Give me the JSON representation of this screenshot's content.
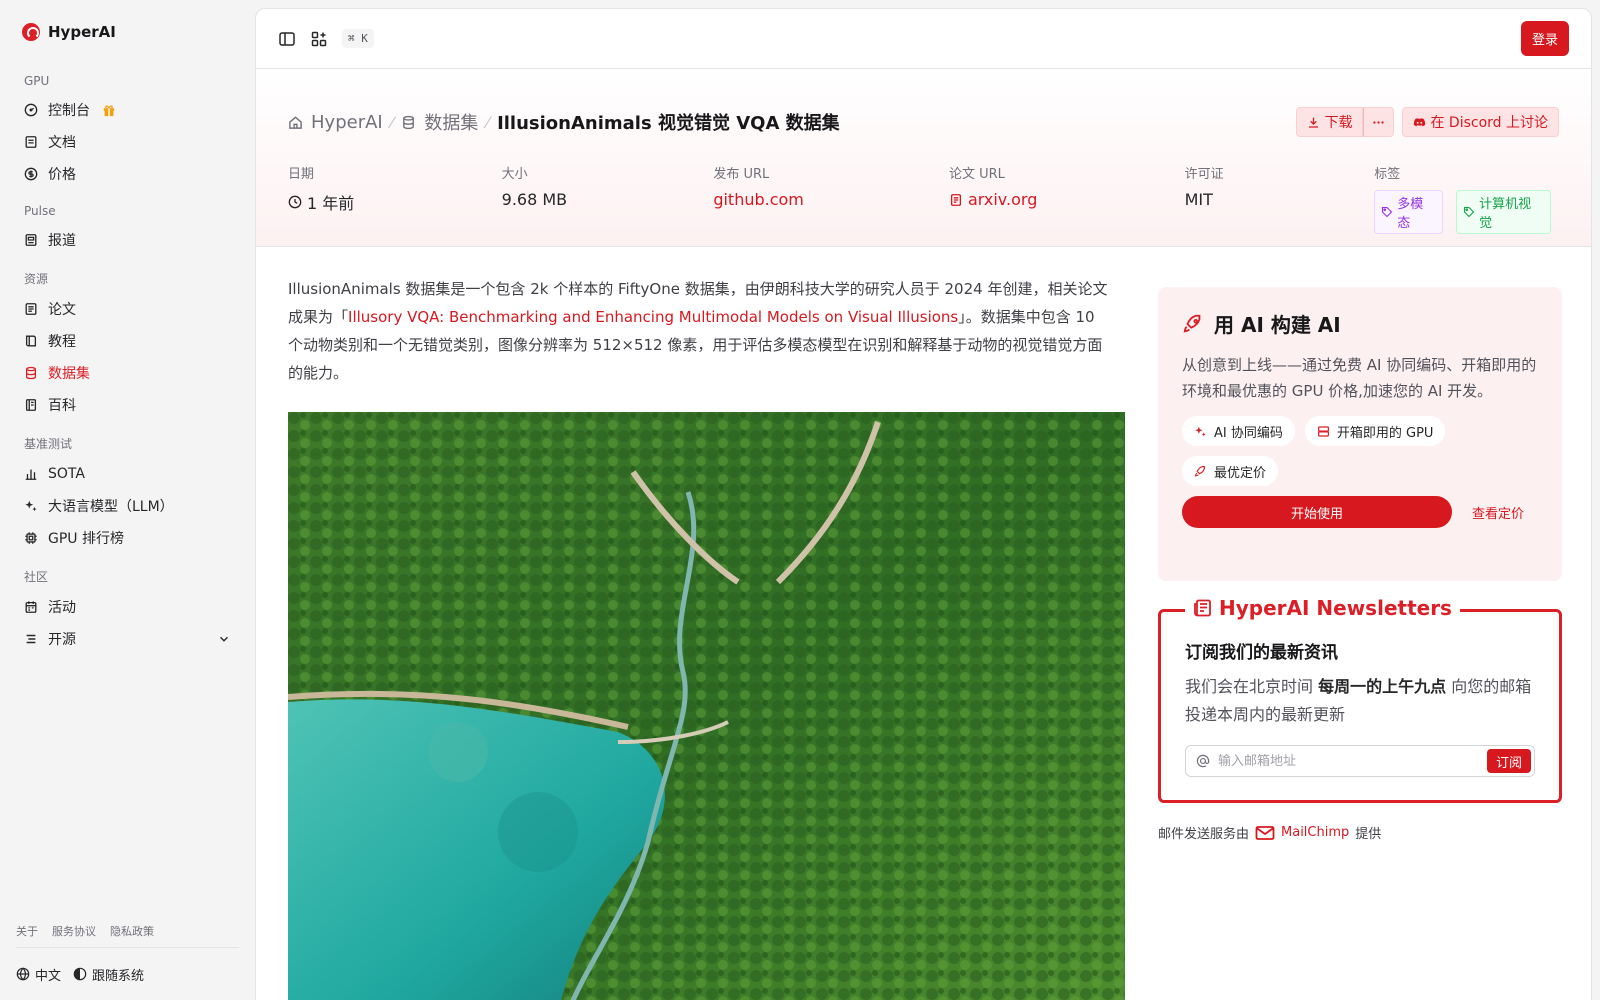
{
  "brand": {
    "name": "HyperAI",
    "color": "#dc1f26"
  },
  "sidebar": {
    "sections": [
      {
        "title": "GPU",
        "items": [
          {
            "label": "控制台",
            "icon": "gauge-icon",
            "badge": "gift-icon"
          },
          {
            "label": "文档",
            "icon": "document-icon"
          },
          {
            "label": "价格",
            "icon": "dollar-icon"
          }
        ]
      },
      {
        "title": "Pulse",
        "items": [
          {
            "label": "报道",
            "icon": "news-icon"
          }
        ]
      },
      {
        "title": "资源",
        "items": [
          {
            "label": "论文",
            "icon": "paper-icon"
          },
          {
            "label": "教程",
            "icon": "book-icon"
          },
          {
            "label": "数据集",
            "icon": "database-icon",
            "active": true
          },
          {
            "label": "百科",
            "icon": "encyclopedia-icon"
          }
        ]
      },
      {
        "title": "基准测试",
        "items": [
          {
            "label": "SOTA",
            "icon": "chart-icon"
          },
          {
            "label": "大语言模型（LLM）",
            "icon": "sparkle-icon"
          },
          {
            "label": "GPU 排行榜",
            "icon": "chip-icon"
          }
        ]
      },
      {
        "title": "社区",
        "items": [
          {
            "label": "活动",
            "icon": "calendar-icon"
          },
          {
            "label": "开源",
            "icon": "list-icon",
            "expandable": true
          }
        ]
      }
    ],
    "footer_links": [
      "关于",
      "服务协议",
      "隐私政策"
    ],
    "language": "中文",
    "theme": "跟随系统"
  },
  "topbar": {
    "shortcut": "⌘ K",
    "login": "登录"
  },
  "breadcrumb": {
    "home": "HyperAI",
    "section": "数据集",
    "current": "IllusionAnimals 视觉错觉 VQA 数据集"
  },
  "actions": {
    "download": "下载",
    "discord": "在 Discord 上讨论"
  },
  "meta": {
    "date": {
      "label": "日期",
      "value": "1 年前"
    },
    "size": {
      "label": "大小",
      "value": "9.68 MB"
    },
    "publish_url": {
      "label": "发布 URL",
      "value": "github.com"
    },
    "paper_url": {
      "label": "论文 URL",
      "value": "arxiv.org"
    },
    "license": {
      "label": "许可证",
      "value": "MIT"
    },
    "tags": {
      "label": "标签",
      "values": [
        "多模态",
        "计算机视觉"
      ]
    }
  },
  "description": {
    "part1": "IllusionAnimals 数据集是一个包含 2k 个样本的 FiftyOne 数据集，由伊朗科技大学的研究人员于 2024 年创建，相关论文成果为「",
    "link": "Illusory VQA: Benchmarking and Enhancing Multimodal Models on Visual Illusions",
    "part2": "」。数据集中包含 10 个动物类别和一个无错觉类别，图像分辨率为 512×512 像素，用于评估多模态模型在识别和解释基于动物的视觉错觉方面的能力。"
  },
  "promo": {
    "title": "用 AI 构建 AI",
    "body": "从创意到上线——通过免费 AI 协同编码、开箱即用的环境和最优惠的 GPU 价格,加速您的 AI 开发。",
    "chips": [
      "AI 协同编码",
      "开箱即用的 GPU",
      "最优定价"
    ],
    "start": "开始使用",
    "pricing": "查看定价"
  },
  "newsletter": {
    "legend": "HyperAI Newsletters",
    "title": "订阅我们的最新资讯",
    "body_pre": "我们会在北京时间 ",
    "body_bold": "每周一的上午九点",
    "body_post": " 向您的邮箱投递本周内的最新更新",
    "placeholder": "输入邮箱地址",
    "subscribe": "订阅",
    "powered_pre": "邮件发送服务由",
    "powered_brand": "MailChimp",
    "powered_post": "提供"
  }
}
